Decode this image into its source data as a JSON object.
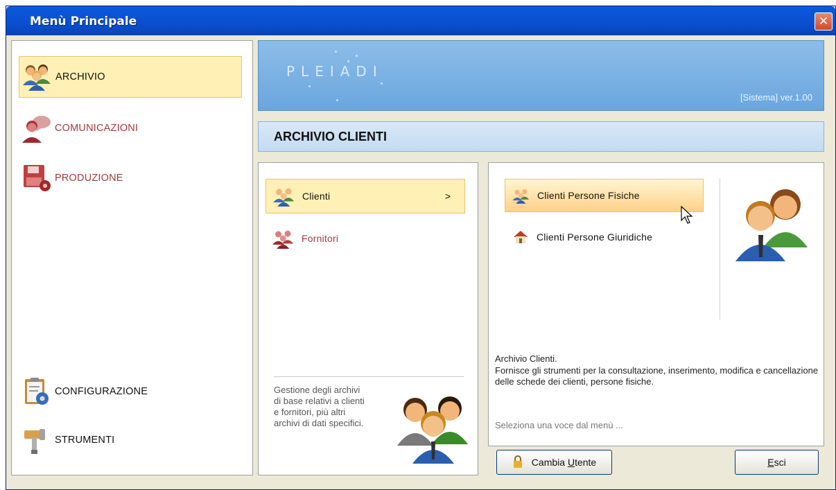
{
  "window": {
    "title": "Menù Principale",
    "close_glyph": "✕"
  },
  "left_nav": {
    "top_items": [
      {
        "label": "ARCHIVIO",
        "icon": "people-icon",
        "active": true
      },
      {
        "label": "COMUNICAZIONI",
        "icon": "speech-person-icon",
        "active": false
      },
      {
        "label": "PRODUZIONE",
        "icon": "floppy-gear-icon",
        "active": false
      }
    ],
    "bottom_items": [
      {
        "label": "CONFIGURAZIONE",
        "icon": "clipboard-gear-icon"
      },
      {
        "label": "STRUMENTI",
        "icon": "hammer-icon"
      }
    ]
  },
  "banner": {
    "logo_text": "PLEIADI",
    "version": "[Sistema]  ver.1.00"
  },
  "section": {
    "title": "ARCHIVIO CLIENTI"
  },
  "submenu": {
    "items": [
      {
        "label": "Clienti",
        "arrow": ">",
        "active": true
      },
      {
        "label": "Fornitori",
        "active": false
      }
    ],
    "description": "Gestione degli archivi di base relativi a clienti e fornitori, più altri archivi di dati specifici."
  },
  "detail": {
    "items": [
      {
        "label": "Clienti Persone Fisiche",
        "icon": "people-icon",
        "active": true
      },
      {
        "label": "Clienti Persone Giuridiche",
        "icon": "house-icon",
        "active": false
      }
    ],
    "info_title": "Archivio Clienti.",
    "info_text": "Fornisce gli strumenti per la consultazione, inserimento, modifica e cancellazione delle schede dei clienti, persone fisiche.",
    "hint": "Seleziona una voce dal menù ..."
  },
  "buttons": {
    "change_user_pre": "Cambia ",
    "change_user_u": "U",
    "change_user_post": "tente",
    "exit_u": "E",
    "exit_post": "sci"
  },
  "colors": {
    "title_bar": "#0a55d6",
    "active_bg": "#fff0b5",
    "banner_bg": "#79b0e2",
    "accent_red": "#a03a3a"
  }
}
